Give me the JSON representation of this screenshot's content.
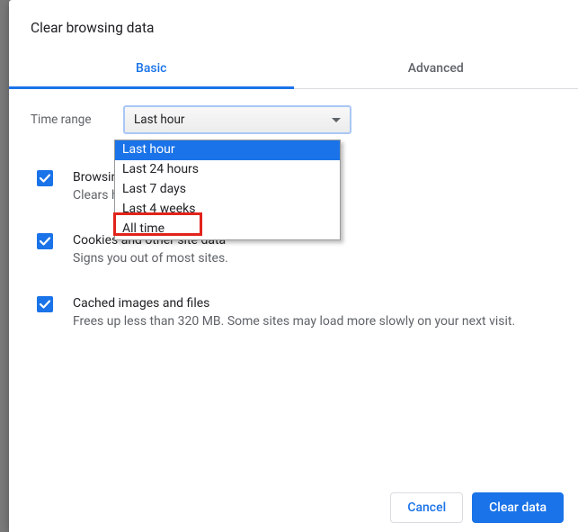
{
  "dialog": {
    "title": "Clear browsing data"
  },
  "tabs": {
    "basic": "Basic",
    "advanced": "Advanced"
  },
  "timerange": {
    "label": "Time range",
    "selected": "Last hour",
    "options": [
      "Last hour",
      "Last 24 hours",
      "Last 7 days",
      "Last 4 weeks",
      "All time"
    ],
    "highlighted_option": "All time"
  },
  "items": {
    "history": {
      "title": "Browsing history",
      "sub": "Clears history"
    },
    "cookies": {
      "title": "Cookies and other site data",
      "sub": "Signs you out of most sites."
    },
    "cache": {
      "title": "Cached images and files",
      "sub": "Frees up less than 320 MB. Some sites may load more slowly on your next visit."
    }
  },
  "buttons": {
    "cancel": "Cancel",
    "clear": "Clear data"
  },
  "colors": {
    "accent": "#1a73e8",
    "highlight": "#e2231a"
  }
}
